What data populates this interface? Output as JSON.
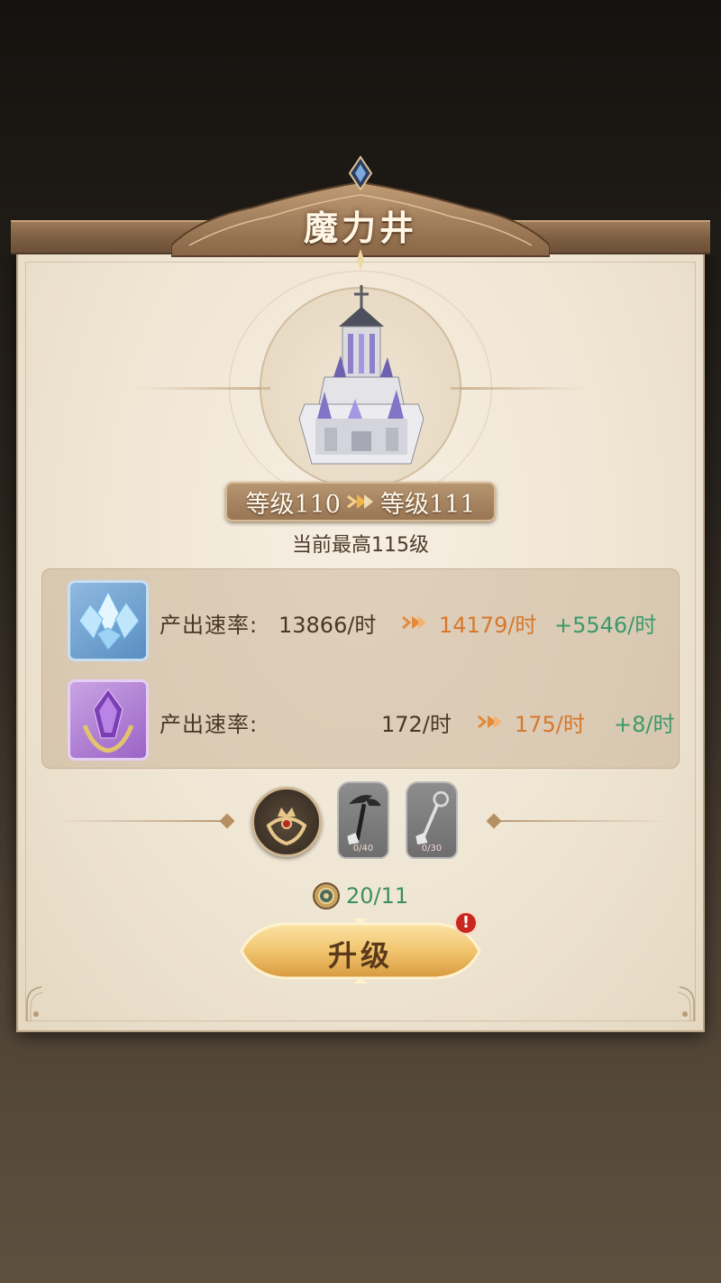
{
  "dialog": {
    "title": "魔力井",
    "level_from": "等级110",
    "level_to": "等级111",
    "max_level_text": "当前最高115级"
  },
  "rates": [
    {
      "icon": "blue-crystal-icon",
      "label": "产出速率:",
      "current": "13866/时",
      "next": "14179/时",
      "bonus": "+5546/时"
    },
    {
      "icon": "purple-crystal-icon",
      "label": "产出速率:",
      "current": "172/时",
      "next": "175/时",
      "bonus": "+8/时"
    }
  ],
  "requirements": {
    "emblem_icon": "crown-emblem-icon",
    "items": [
      {
        "icon": "winged-sword-icon",
        "count": "0/40"
      },
      {
        "icon": "staff-icon",
        "count": "0/30"
      }
    ]
  },
  "cost": {
    "icon": "gear-coin-icon",
    "value": "20/11"
  },
  "upgrade_button": {
    "label": "升级",
    "alert": "!"
  },
  "colors": {
    "next_value": "#d6782d",
    "bonus_value": "#3c9a6a",
    "cost_value": "#3c8f5e",
    "alert": "#c8261f"
  }
}
